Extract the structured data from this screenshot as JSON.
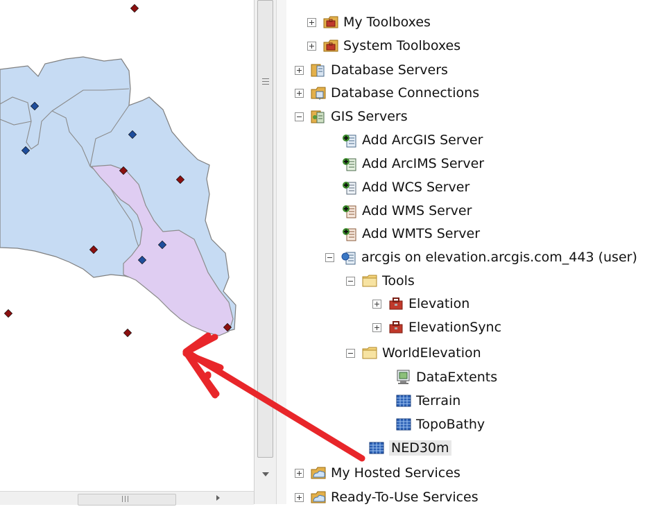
{
  "colors": {
    "watershed_fill": "#c6dbf3",
    "selected_fill": "#dfcdf2",
    "boundary": "#7f7f7f",
    "gauge_point": "#1f4e9c",
    "sample_point": "#8b1010",
    "arrow": "#e8262a"
  },
  "map": {
    "layer_names": [
      "watershed-polygons",
      "selected-watershed",
      "gauge-points",
      "sample-points",
      "annotation-arrow"
    ]
  },
  "catalog": {
    "items": [
      {
        "label": "My Toolboxes",
        "icon": "toolbox-folder-icon",
        "expander": "plus"
      },
      {
        "label": "System Toolboxes",
        "icon": "toolbox-folder-icon",
        "expander": "plus"
      },
      {
        "label": "Database Servers",
        "icon": "database-server-icon",
        "expander": "plus"
      },
      {
        "label": "Database Connections",
        "icon": "database-connection-icon",
        "expander": "plus"
      },
      {
        "label": "GIS Servers",
        "icon": "gis-server-icon",
        "expander": "minus"
      },
      {
        "label": "Add ArcGIS Server",
        "icon": "add-server-icon",
        "expander": "none"
      },
      {
        "label": "Add ArcIMS Server",
        "icon": "add-server-icon",
        "expander": "none"
      },
      {
        "label": "Add WCS Server",
        "icon": "add-server-icon",
        "expander": "none"
      },
      {
        "label": "Add WMS Server",
        "icon": "add-server-icon",
        "expander": "none"
      },
      {
        "label": "Add WMTS Server",
        "icon": "add-server-icon",
        "expander": "none"
      },
      {
        "label": "arcgis on elevation.arcgis.com_443 (user)",
        "icon": "server-connection-icon",
        "expander": "minus"
      },
      {
        "label": "Tools",
        "icon": "folder-icon",
        "expander": "minus"
      },
      {
        "label": "Elevation",
        "icon": "toolbox-icon",
        "expander": "plus"
      },
      {
        "label": "ElevationSync",
        "icon": "toolbox-icon",
        "expander": "plus"
      },
      {
        "label": "WorldElevation",
        "icon": "folder-icon",
        "expander": "minus"
      },
      {
        "label": "DataExtents",
        "icon": "map-service-icon",
        "expander": "none"
      },
      {
        "label": "Terrain",
        "icon": "image-service-icon",
        "expander": "none"
      },
      {
        "label": "TopoBathy",
        "icon": "image-service-icon",
        "expander": "none"
      },
      {
        "label": "NED30m",
        "icon": "image-service-icon",
        "expander": "none"
      },
      {
        "label": "My Hosted Services",
        "icon": "hosted-services-icon",
        "expander": "plus"
      },
      {
        "label": "Ready-To-Use Services",
        "icon": "hosted-services-icon",
        "expander": "plus"
      }
    ],
    "selected": "NED30m"
  }
}
